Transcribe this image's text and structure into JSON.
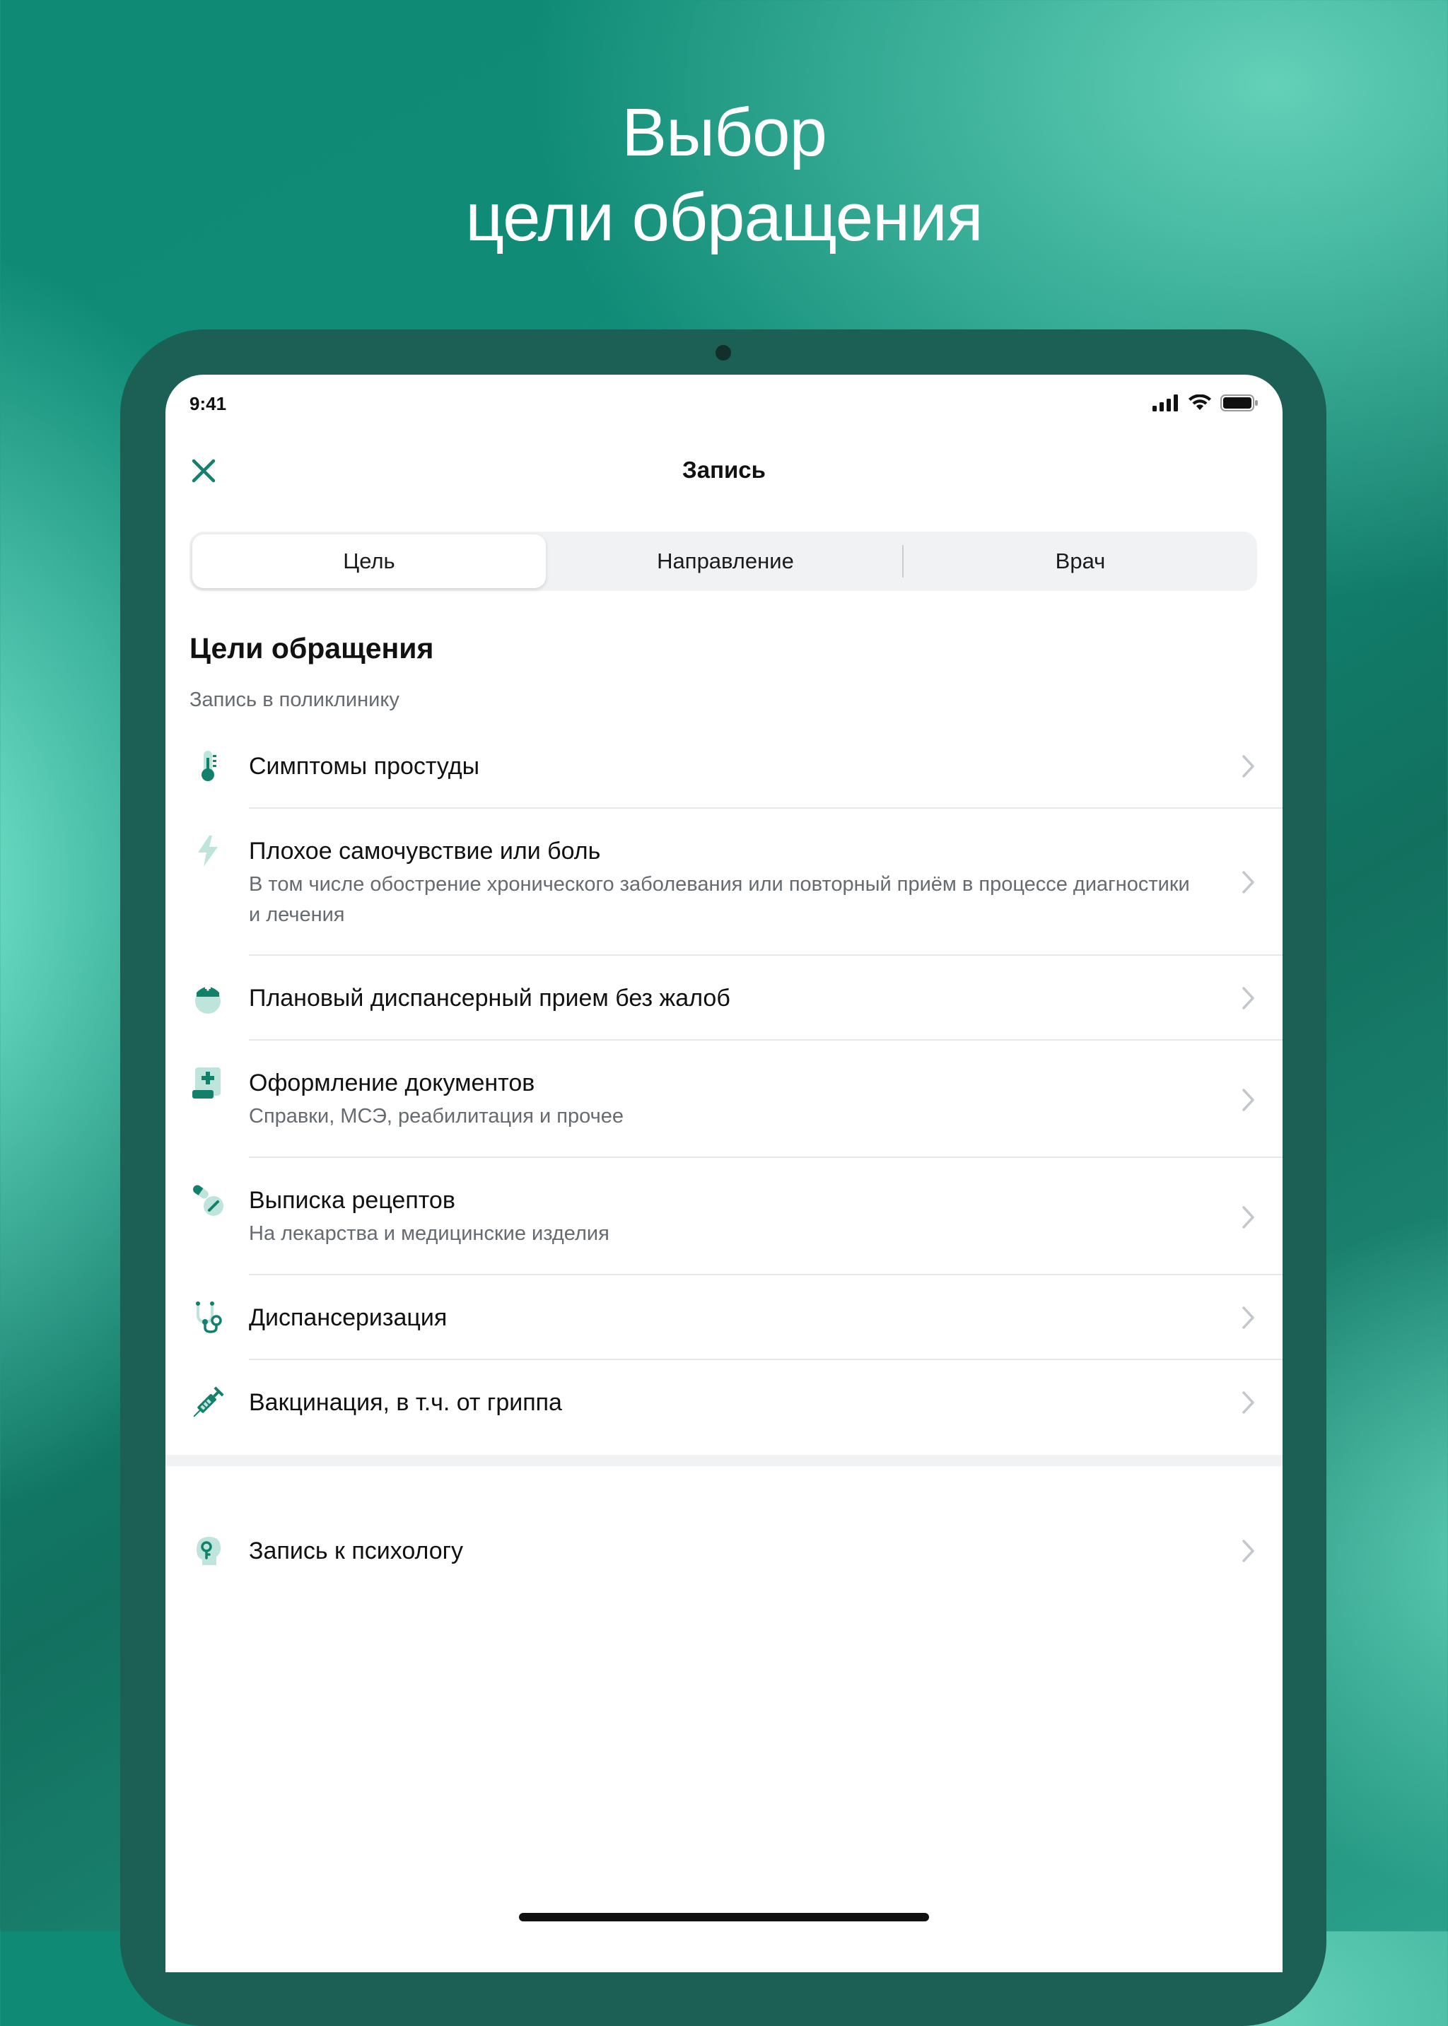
{
  "headline": {
    "line1": "Выбор",
    "line2": "цели обращения"
  },
  "status_bar": {
    "time": "9:41"
  },
  "nav": {
    "title": "Запись"
  },
  "tabs": [
    {
      "label": "Цель",
      "active": true
    },
    {
      "label": "Направление",
      "active": false
    },
    {
      "label": "Врач",
      "active": false
    }
  ],
  "section": {
    "title": "Цели обращения",
    "subtitle": "Запись в поликлинику"
  },
  "items": [
    {
      "title": "Симптомы простуды",
      "icon": "thermometer-icon"
    },
    {
      "title": "Плохое самочувствие или боль",
      "subtitle": "В том числе обострение хронического заболевания или повторный приём в процессе диагностики и лечения",
      "icon": "lightning-icon"
    },
    {
      "title": "Плановый диспансерный прием без жалоб",
      "icon": "nurse-icon"
    },
    {
      "title": "Оформление документов",
      "subtitle": "Справки, МСЭ, реабилитация и прочее",
      "icon": "medical-document-icon"
    },
    {
      "title": "Выписка рецептов",
      "subtitle": "На лекарства и медицинские изделия",
      "icon": "pills-icon"
    },
    {
      "title": "Диспансеризация",
      "icon": "stethoscope-icon"
    },
    {
      "title": "Вакцинация, в т.ч. от гриппа",
      "icon": "syringe-icon"
    }
  ],
  "psychologist": {
    "title": "Запись к психологу",
    "icon": "head-key-icon"
  },
  "colors": {
    "accent": "#12806b",
    "accent_light": "#bfe4dc",
    "background_dark": "#1c5f54"
  }
}
